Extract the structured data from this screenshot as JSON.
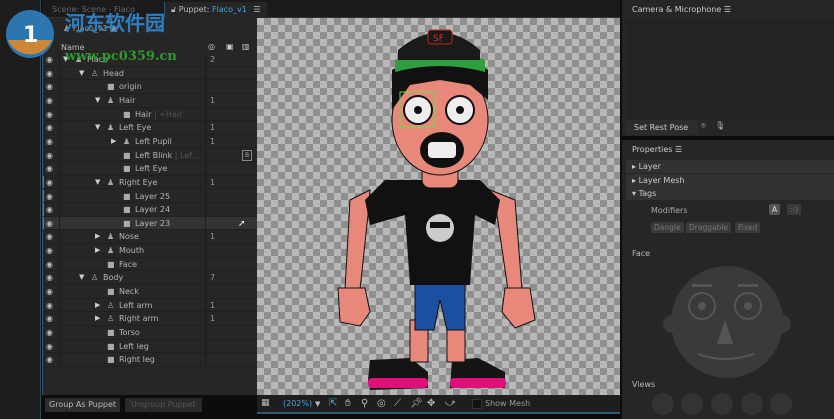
{
  "tabs": {
    "scene": "Scene: Scene - Flaco",
    "puppet_prefix": "Puppet:",
    "puppet_name": "Flaco_v1"
  },
  "puppet": {
    "title": "Flaco_v1",
    "col_name": "Name",
    "rows": [
      {
        "label": "Flaco",
        "level": 0,
        "type": "group",
        "expanded": true,
        "count": "2"
      },
      {
        "label": "Head",
        "level": 1,
        "type": "group-outline",
        "expanded": true,
        "count": ""
      },
      {
        "label": "origin",
        "level": 2,
        "type": "layer",
        "count": ""
      },
      {
        "label": "Hair",
        "level": 2,
        "type": "group",
        "expanded": true,
        "count": "1"
      },
      {
        "label": "Hair",
        "sub": "| +Hair",
        "level": 3,
        "type": "layer",
        "count": ""
      },
      {
        "label": "Left Eye",
        "level": 2,
        "type": "group",
        "expanded": true,
        "count": "1"
      },
      {
        "label": "Left Pupil",
        "level": 3,
        "type": "group",
        "expanded": false,
        "count": "1"
      },
      {
        "label": "Left Blink",
        "sub": "| Lef...",
        "level": 3,
        "type": "layer",
        "count": "",
        "badge": "B"
      },
      {
        "label": "Left Eye",
        "level": 3,
        "type": "layer",
        "count": ""
      },
      {
        "label": "Right Eye",
        "level": 2,
        "type": "group",
        "expanded": true,
        "count": "1"
      },
      {
        "label": "Layer 25",
        "level": 3,
        "type": "layer",
        "count": ""
      },
      {
        "label": "Layer 24",
        "level": 3,
        "type": "layer",
        "count": ""
      },
      {
        "label": "Layer 23",
        "level": 3,
        "type": "layer",
        "count": "",
        "selected": true
      },
      {
        "label": "Nose",
        "level": 2,
        "type": "group",
        "expanded": false,
        "count": "1"
      },
      {
        "label": "Mouth",
        "level": 2,
        "type": "group",
        "expanded": false,
        "count": ""
      },
      {
        "label": "Face",
        "level": 2,
        "type": "layer",
        "count": ""
      },
      {
        "label": "Body",
        "level": 1,
        "type": "group-outline",
        "expanded": true,
        "count": "7"
      },
      {
        "label": "Neck",
        "level": 2,
        "type": "layer",
        "count": ""
      },
      {
        "label": "Left arm",
        "level": 2,
        "type": "group-outline",
        "expanded": false,
        "count": "1"
      },
      {
        "label": "Right arm",
        "level": 2,
        "type": "group-outline",
        "expanded": false,
        "count": "1"
      },
      {
        "label": "Torso",
        "level": 2,
        "type": "layer",
        "count": ""
      },
      {
        "label": "Left leg",
        "level": 2,
        "type": "layer",
        "count": ""
      },
      {
        "label": "Right leg",
        "level": 2,
        "type": "layer",
        "count": ""
      }
    ],
    "group_button": "Group As Puppet",
    "ungroup_button": "Ungroup Puppet"
  },
  "canvas": {
    "zoom": "(202%)",
    "show_mesh": "Show Mesh",
    "hat_text": "SF"
  },
  "camera": {
    "title": "Camera & Microphone",
    "set_rest_pose": "Set Rest Pose"
  },
  "properties": {
    "title": "Properties",
    "sections": [
      "Layer",
      "Layer Mesh",
      "Tags"
    ],
    "modifiers_label": "Modifiers",
    "modifier_a": "A",
    "modifier_face": ":-)",
    "tags": [
      "Dangle",
      "Draggable",
      "Fixed"
    ],
    "face_label": "Face",
    "views_label": "Views"
  },
  "watermark": {
    "name": "河东软件园",
    "url": "www.pc0359.cn"
  },
  "colors": {
    "accent": "#2d8bc0",
    "shoe": "#e0107a",
    "shorts": "#1b4fa0",
    "skin": "#e8887a"
  }
}
